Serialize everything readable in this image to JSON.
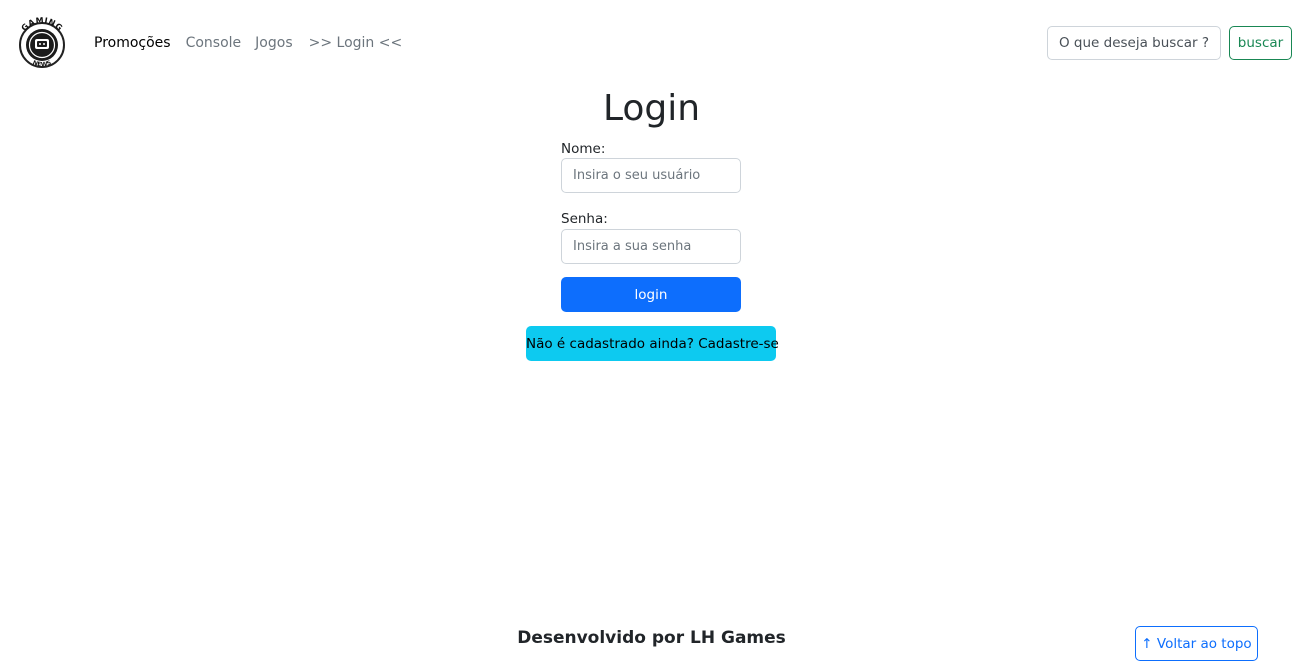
{
  "brand": {
    "logo_text_top": "GAMING",
    "logo_text_bottom": "NEWS"
  },
  "nav": {
    "items": [
      {
        "label": "Promoções"
      },
      {
        "label": "Console"
      },
      {
        "label": "Jogos"
      },
      {
        "label": ">> Login <<"
      }
    ]
  },
  "search": {
    "placeholder": "O que deseja buscar ?",
    "button_label": "buscar"
  },
  "login": {
    "title": "Login",
    "name_label": "Nome:",
    "name_placeholder": "Insira o seu usuário",
    "password_label": "Senha:",
    "password_placeholder": "Insira a sua senha",
    "submit_label": "login",
    "signup_label": "Não é cadastrado ainda? Cadastre-se"
  },
  "footer": {
    "text": "Desenvolvido por LH Games",
    "back_to_top_label": "↑ Voltar ao topo"
  },
  "colors": {
    "primary": "#0d6efd",
    "info": "#0dcaf0",
    "success": "#198754",
    "muted": "#6c757d"
  }
}
